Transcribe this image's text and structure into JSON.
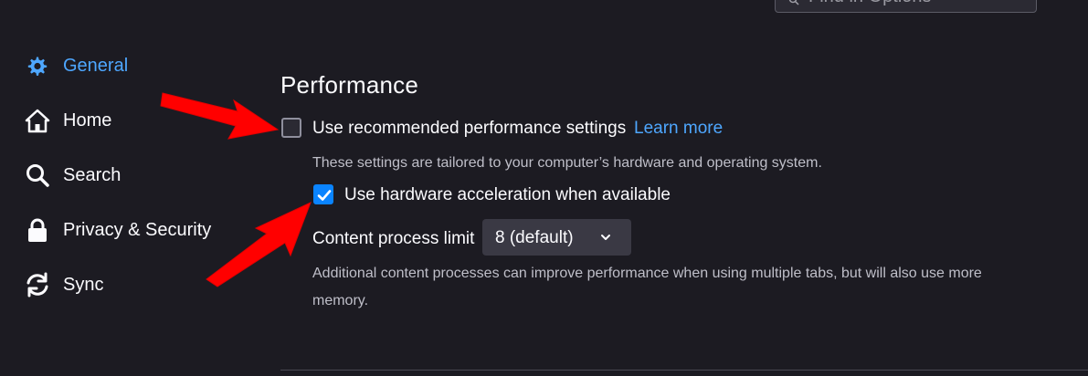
{
  "search": {
    "placeholder": "Find in Options"
  },
  "sidebar": {
    "items": [
      {
        "label": "General",
        "icon": "gear-icon",
        "active": true
      },
      {
        "label": "Home",
        "icon": "home-icon",
        "active": false
      },
      {
        "label": "Search",
        "icon": "search-icon",
        "active": false
      },
      {
        "label": "Privacy & Security",
        "icon": "lock-icon",
        "active": false
      },
      {
        "label": "Sync",
        "icon": "sync-icon",
        "active": false
      }
    ]
  },
  "performance": {
    "title": "Performance",
    "recommended": {
      "label": "Use recommended performance settings",
      "checked": false,
      "learn_more": "Learn more",
      "description": "These settings are tailored to your computer’s hardware and operating system."
    },
    "hardware_accel": {
      "label": "Use hardware acceleration when available",
      "checked": true
    },
    "content_process": {
      "label": "Content process limit",
      "value": "8 (default)",
      "description_line1": "Additional content processes can improve performance when using multiple tabs, but will also use more",
      "description_line2": "memory."
    }
  },
  "colors": {
    "background": "#1c1b22",
    "accent": "#0a84ff",
    "link": "#4ea7ff",
    "annotation_arrow": "#ff0000"
  }
}
